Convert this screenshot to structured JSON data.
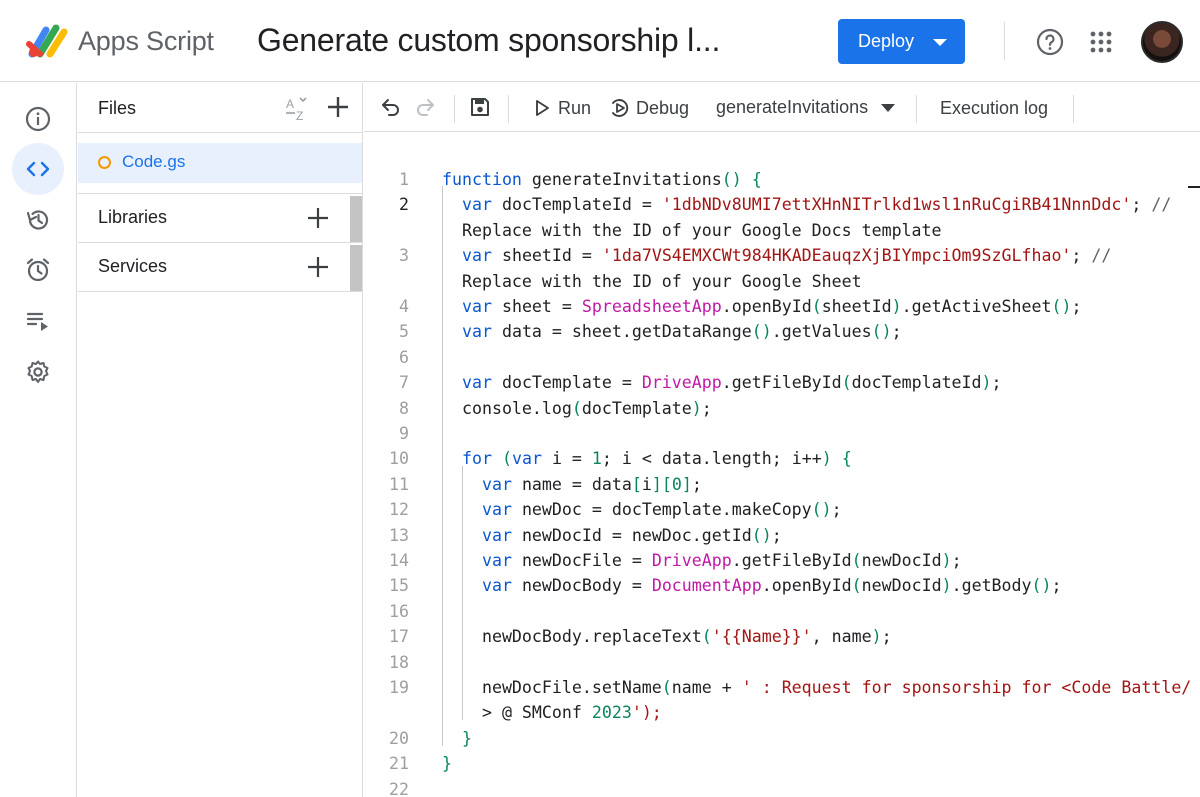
{
  "header": {
    "app_name": "Apps Script",
    "project_title": "Generate custom sponsorship l...",
    "deploy_label": "Deploy",
    "help_icon": "help-circle-icon",
    "apps_icon": "google-apps-grid-icon"
  },
  "rail": {
    "items": [
      {
        "name": "overview",
        "icon": "info-icon"
      },
      {
        "name": "editor",
        "icon": "code-brackets-icon",
        "active": true
      },
      {
        "name": "project-history",
        "icon": "history-icon"
      },
      {
        "name": "triggers",
        "icon": "alarm-clock-icon"
      },
      {
        "name": "executions",
        "icon": "list-play-icon"
      },
      {
        "name": "project-settings",
        "icon": "gear-icon"
      }
    ]
  },
  "files": {
    "title": "Files",
    "items": [
      {
        "name": "Code.gs"
      }
    ],
    "sections": [
      {
        "label": "Libraries"
      },
      {
        "label": "Services"
      }
    ]
  },
  "toolbar": {
    "run_label": "Run",
    "debug_label": "Debug",
    "function_selected": "generateInvitations",
    "execution_log_label": "Execution log"
  },
  "editor": {
    "current_line": 2,
    "line_numbers": [
      "1",
      "2",
      "",
      "3",
      "",
      "4",
      "5",
      "6",
      "7",
      "8",
      "9",
      "10",
      "11",
      "12",
      "13",
      "14",
      "15",
      "16",
      "17",
      "18",
      "19",
      "",
      "20",
      "21",
      "22"
    ],
    "lines": [
      "function generateInvitations() {",
      "  var docTemplateId = '1dbNDv8UMI7ettXHnNITrlkd1wsl1nRuCgiRB41NnnDdc'; //",
      "  Replace with the ID of your Google Docs template",
      "  var sheetId = '1da7VS4EMXCWt984HKADEauqzXjBIYmpciOm9SzGLfhao'; //",
      "  Replace with the ID of your Google Sheet",
      "  var sheet = SpreadsheetApp.openById(sheetId).getActiveSheet();",
      "  var data = sheet.getDataRange().getValues();",
      "",
      "  var docTemplate = DriveApp.getFileById(docTemplateId);",
      "  console.log(docTemplate);",
      "",
      "  for (var i = 1; i < data.length; i++) {",
      "    var name = data[i][0];",
      "    var newDoc = docTemplate.makeCopy();",
      "    var newDocId = newDoc.getId();",
      "    var newDocFile = DriveApp.getFileById(newDocId);",
      "    var newDocBody = DocumentApp.openById(newDocId).getBody();",
      "",
      "    newDocBody.replaceText('{{Name}}', name);",
      "",
      "    newDocFile.setName(name + ' : Request for sponsorship for <Code Battle/",
      "    > @ SMConf 2023');",
      "  }",
      "}",
      ""
    ]
  },
  "colors": {
    "accent": "#1a73e8",
    "keyword": "#1a1aa6",
    "string": "#a31515",
    "number": "#098658",
    "class_name": "#c019a6"
  }
}
